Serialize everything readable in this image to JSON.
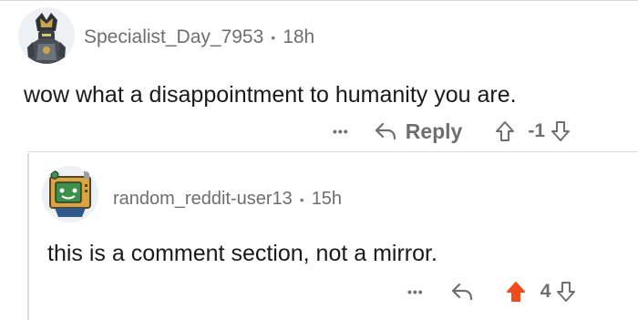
{
  "comment": {
    "username": "Specialist_Day_7953",
    "separator": "•",
    "time": "18h",
    "text": "wow what a disappointment to humanity you are.",
    "more": "•••",
    "reply_label": "Reply",
    "score": "-1",
    "avatar": "avatar-armored-character"
  },
  "reply": {
    "username": "random_reddit-user13",
    "separator": "•",
    "time": "15h",
    "text": "this is a comment section, not a mirror.",
    "more": "•••",
    "score": "4",
    "upvoted": true,
    "upvote_color": "#f04a1d",
    "avatar": "avatar-retro-computer"
  },
  "colors": {
    "meta": "#6c6e70",
    "text": "#1a1a1b",
    "thread_line": "#dcdcdc"
  }
}
